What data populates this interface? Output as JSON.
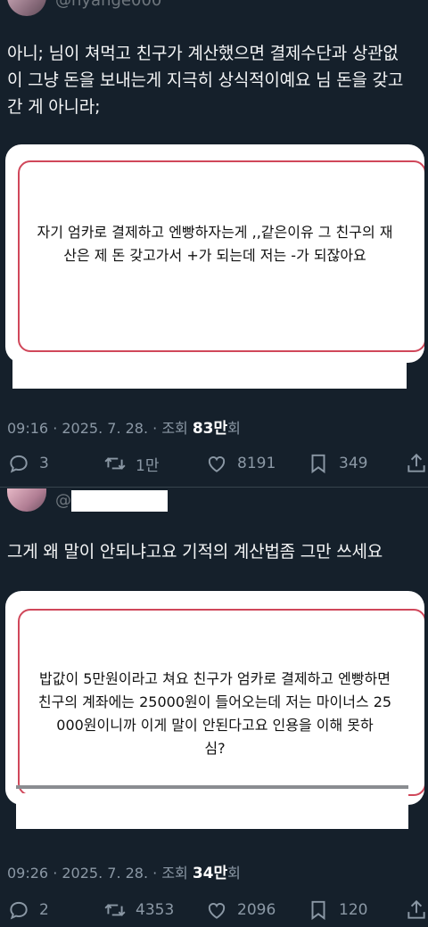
{
  "tweet1": {
    "handle": "@hyange000",
    "text_line1": "아니; 님이 쳐먹고 친구가 계산했으면 결제수단과 상관없",
    "text_line2": "이 그냥 돈을 보내는게 지극히 상식적이예요 님 돈을 갖고",
    "text_line3": "간 게 아니라;",
    "card_line1": "자기 엄카로 결제하고 엔빵하자는게 ,,같은이유 그 친구의 재",
    "card_line2": "산은 제 돈 갖고가서 +가 되는데 저는 -가 되잖아요",
    "time": "09:16 · 2025. 7. 28. · 조회 ",
    "views": "83만",
    "views_suffix": "회",
    "replies": "3",
    "retweets": "1만",
    "likes": "8191",
    "bookmarks": "349"
  },
  "tweet2": {
    "handle": "@",
    "text": "그게 왜 말이 안되냐고요 기적의 계산법좀 그만 쓰세요",
    "card_line1": "밥값이 5만원이라고 쳐요 친구가 엄카로 결제하고 엔빵하면",
    "card_line2": "친구의 계좌에는 25000원이 들어오는데 저는 마이너스 25",
    "card_line3": "000원이니까 이게 말이 안된다고요        인용을 이해 못하",
    "card_line4": "심?",
    "time": "09:26 · 2025. 7. 28. · 조회 ",
    "views": "34만",
    "views_suffix": "회",
    "replies": "2",
    "retweets": "4353",
    "likes": "2096",
    "bookmarks": "120"
  },
  "colors": {
    "background": "#15202b",
    "muted": "#8b98a5",
    "card_outline": "#d0475a"
  },
  "icons": [
    "reply-icon",
    "retweet-icon",
    "like-icon",
    "bookmark-icon",
    "share-icon"
  ]
}
